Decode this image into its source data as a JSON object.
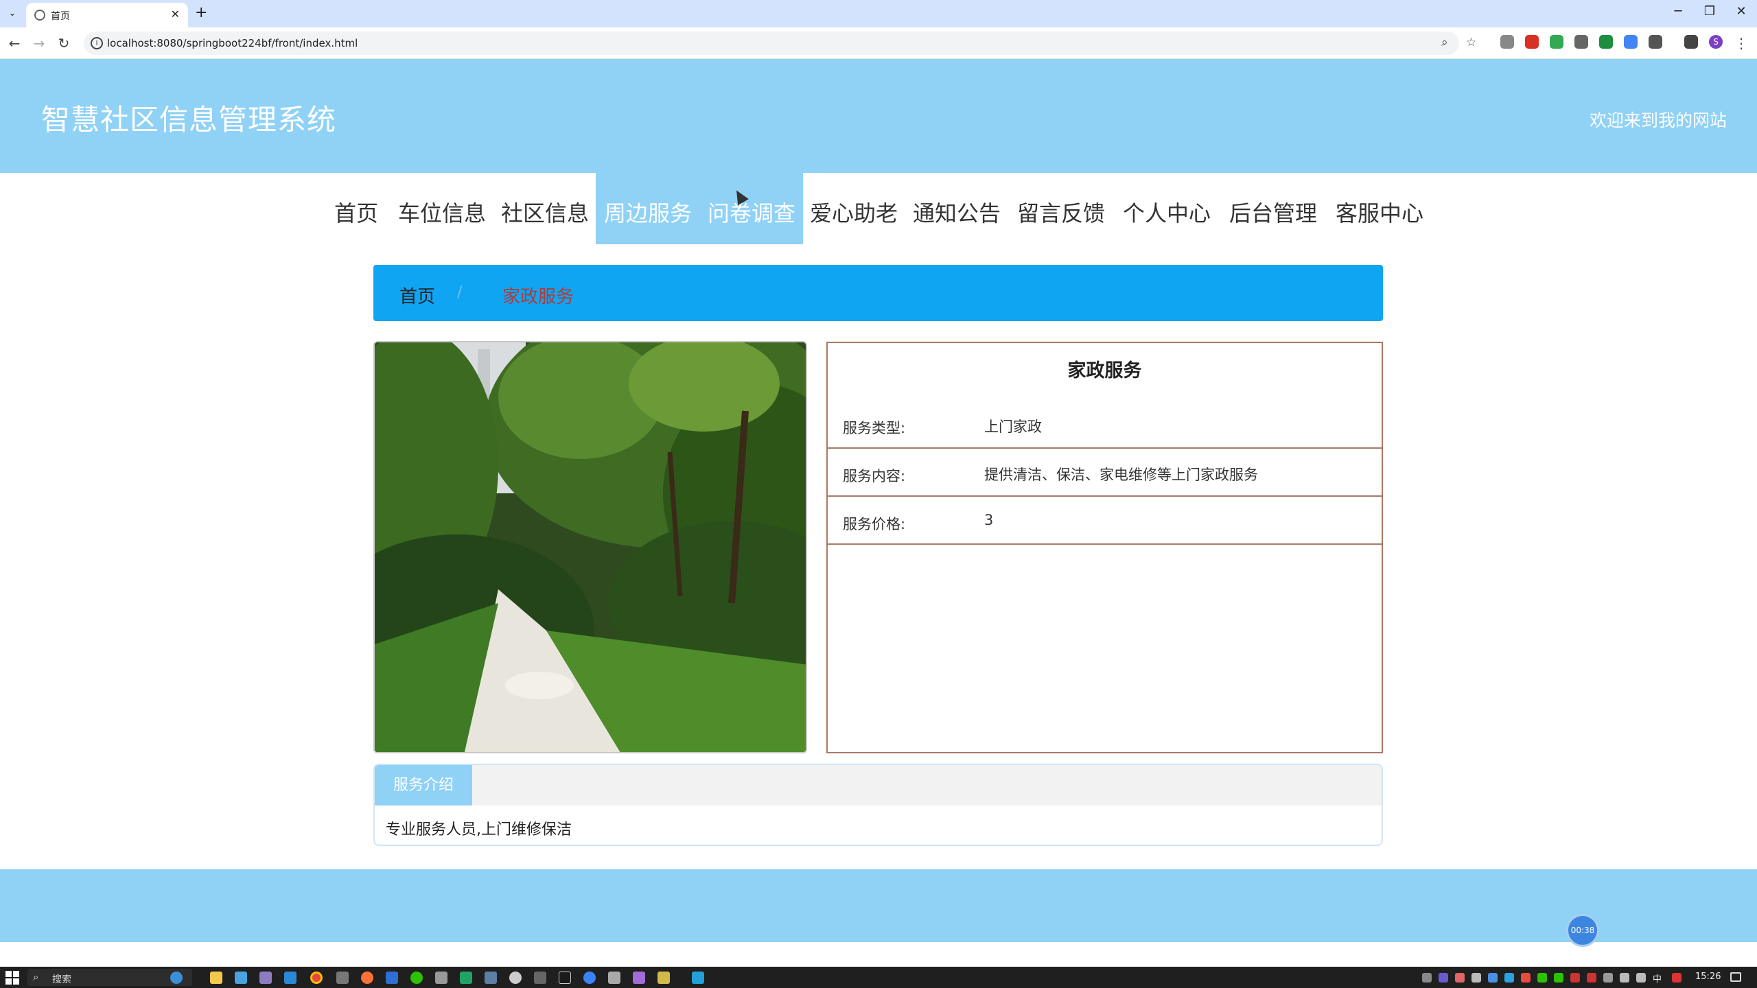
{
  "browser": {
    "tab_list_glyph": "⌄",
    "tab_title": "首页",
    "tab_close_glyph": "✕",
    "new_tab_glyph": "+",
    "window_controls": {
      "minimize": "─",
      "restore": "❐",
      "close": "✕"
    },
    "back_glyph": "←",
    "forward_glyph": "→",
    "reload_glyph": "↻",
    "url": "localhost:8080/springboot224bf/front/index.html",
    "site_info_glyph": "i",
    "zoom_glyph": "⌕",
    "bookmark_glyph": "☆",
    "menu_glyph": "⋮",
    "profile_initial": "S"
  },
  "site": {
    "title": "智慧社区信息管理系统",
    "welcome": "欢迎来到我的网站"
  },
  "nav": [
    {
      "label": "首页",
      "active": false
    },
    {
      "label": "车位信息",
      "active": false
    },
    {
      "label": "社区信息",
      "active": false
    },
    {
      "label": "周边服务",
      "active": true
    },
    {
      "label": "问卷调查",
      "active": true
    },
    {
      "label": "爱心助老",
      "active": false
    },
    {
      "label": "通知公告",
      "active": false
    },
    {
      "label": "留言反馈",
      "active": false
    },
    {
      "label": "个人中心",
      "active": false
    },
    {
      "label": "后台管理",
      "active": false
    },
    {
      "label": "客服中心",
      "active": false
    }
  ],
  "breadcrumb": {
    "home": "首页",
    "separator": "/",
    "current": "家政服务"
  },
  "detail": {
    "title": "家政服务",
    "rows": [
      {
        "label": "服务类型:",
        "value": "上门家政"
      },
      {
        "label": "服务内容:",
        "value": "提供清洁、保洁、家电维修等上门家政服务"
      },
      {
        "label": "服务价格:",
        "value": "3"
      }
    ]
  },
  "intro": {
    "tab_label": "服务介绍",
    "text": "专业服务人员,上门维修保洁"
  },
  "timer": "00:38",
  "taskbar": {
    "search_glyph": "⌕",
    "search_placeholder": "搜索",
    "ime": "中",
    "time": "15:26"
  },
  "colors": {
    "header_bg": "#90d1f6",
    "breadcrumb_bg": "#10a5f2",
    "breadcrumb_current": "#b13b3b",
    "detail_border": "#a87b66"
  }
}
